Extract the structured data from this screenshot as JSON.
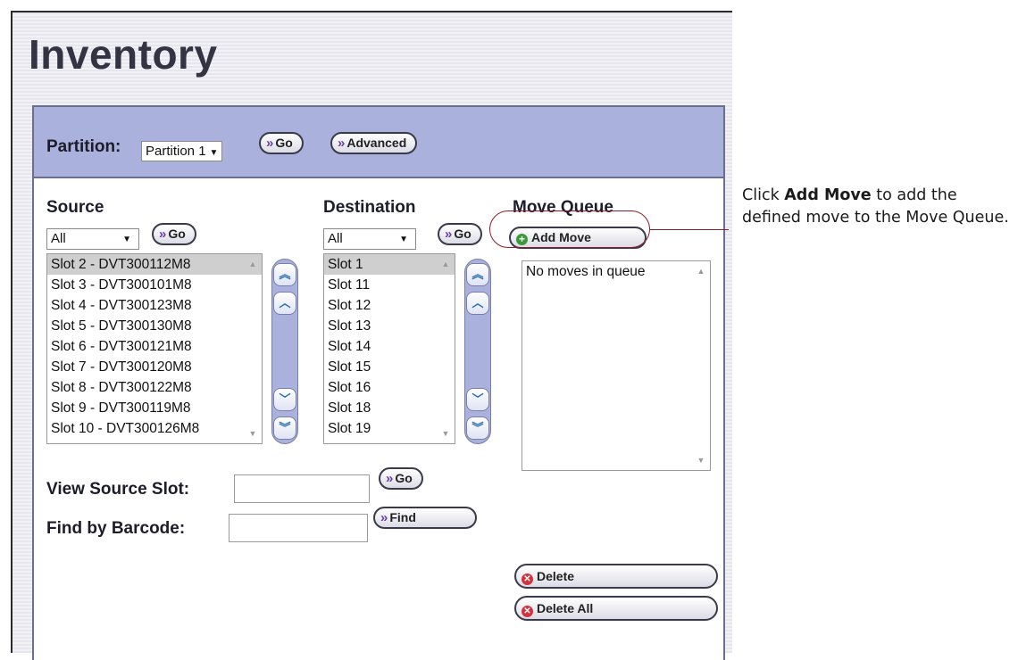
{
  "page": {
    "title": "Inventory"
  },
  "partition": {
    "label": "Partition:",
    "selected": "Partition 1",
    "go_label": "Go",
    "advanced_label": "Advanced"
  },
  "source": {
    "heading": "Source",
    "filter": "All",
    "go_label": "Go",
    "items": [
      "Slot 2 - DVT300112M8",
      "Slot 3 - DVT300101M8",
      "Slot 4 - DVT300123M8",
      "Slot 5 - DVT300130M8",
      "Slot 6 - DVT300121M8",
      "Slot 7 - DVT300120M8",
      "Slot 8 - DVT300122M8",
      "Slot 9 - DVT300119M8",
      "Slot 10 - DVT300126M8"
    ],
    "selected_index": 0
  },
  "destination": {
    "heading": "Destination",
    "filter": "All",
    "go_label": "Go",
    "items": [
      "Slot 1",
      "Slot 11",
      "Slot 12",
      "Slot 13",
      "Slot 14",
      "Slot 15",
      "Slot 16",
      "Slot 18",
      "Slot 19"
    ],
    "selected_index": 0
  },
  "move_queue": {
    "heading": "Move Queue",
    "add_label": "Add Move",
    "empty_text": "No moves in queue",
    "delete_label": "Delete",
    "delete_all_label": "Delete All"
  },
  "view_source_slot": {
    "label": "View Source Slot:",
    "value": "",
    "go_label": "Go"
  },
  "find_by_barcode": {
    "label": "Find by Barcode:",
    "value": "",
    "find_label": "Find"
  },
  "callout": {
    "text_before": "Click ",
    "bold": "Add Move",
    "text_after": " to add the defined move to the Move Queue."
  },
  "colors": {
    "panel_header": "#a9b1dc",
    "callout_line": "#8b1b2a",
    "delete_icon": "#d2323c",
    "add_icon": "#3a9a3a"
  }
}
